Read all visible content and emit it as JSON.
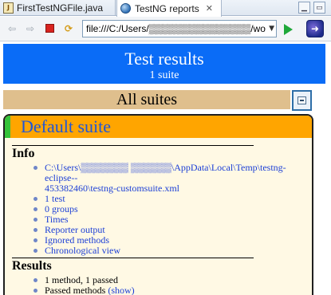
{
  "tabs": [
    {
      "label": "FirstTestNGFile.java",
      "icon": "java-file-icon"
    },
    {
      "label": "TestNG reports",
      "icon": "globe-icon",
      "close": "✕"
    }
  ],
  "toolbar": {
    "url": "file:///C:/Users/▒▒▒▒▒▒▒▒▒▒▒▒▒▒▒/wo"
  },
  "header": {
    "title": "Test results",
    "subtitle": "1 suite"
  },
  "suites_bar": {
    "label": "All suites"
  },
  "suite": {
    "name": "Default suite",
    "info": {
      "title": "Info",
      "items": [
        {
          "line1": "C:\\Users\\▒▒▒▒▒▒▒ ▒▒▒▒▒▒\\AppData\\Local\\Temp\\testng-eclipse--",
          "line2": "453382460\\testng-customsuite.xml"
        },
        {
          "label": "1 test"
        },
        {
          "label": "0 groups"
        },
        {
          "label": "Times"
        },
        {
          "label": "Reporter output"
        },
        {
          "label": "Ignored methods"
        },
        {
          "label": "Chronological view"
        }
      ]
    },
    "results": {
      "title": "Results",
      "items": [
        {
          "label": "1 method, 1 passed"
        },
        {
          "label": "Passed methods",
          "action": "(show)"
        }
      ]
    }
  },
  "colors": {
    "header_bg": "#0a6cf7",
    "suites_bar_bg": "#dfbf8d",
    "suite_head_bg": "#ffa500",
    "suite_passed_marker": "#35c23a",
    "card_bg": "#fff9e4",
    "link": "#1c3fd6"
  }
}
